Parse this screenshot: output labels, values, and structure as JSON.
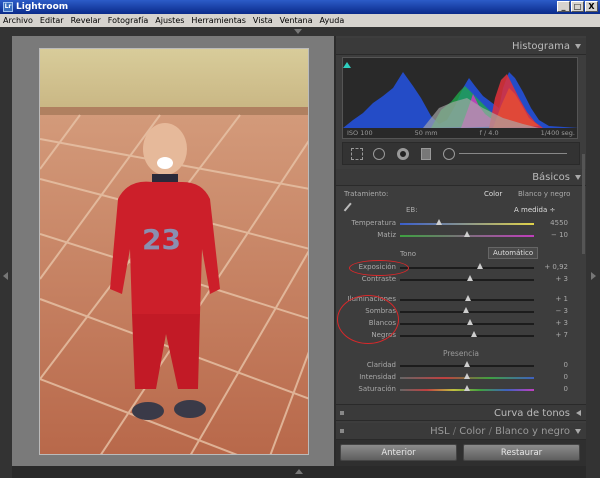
{
  "window": {
    "title": "Lightroom",
    "logo": "Lr",
    "controls": [
      "_",
      "□",
      "X"
    ]
  },
  "menu": [
    "Archivo",
    "Editar",
    "Revelar",
    "Fotografía",
    "Ajustes",
    "Herramientas",
    "Vista",
    "Ventana",
    "Ayuda"
  ],
  "histogram": {
    "title": "Histograma",
    "iso": "ISO 100",
    "focal": "50 mm",
    "aperture": "f / 4.0",
    "shutter": "1/400 seg."
  },
  "basic": {
    "title": "Básicos",
    "treatment_label": "Tratamiento:",
    "treatment_color": "Color",
    "treatment_bw": "Blanco y negro",
    "wb_label": "EB:",
    "wb_value": "A medida ÷",
    "temp_label": "Temperatura",
    "temp_value": "4550",
    "tint_label": "Matiz",
    "tint_value": "− 10",
    "tone_label": "Tono",
    "auto_label": "Automático",
    "sliders": [
      {
        "label": "Exposición",
        "value": "+ 0,92",
        "pos": 0.6
      },
      {
        "label": "Contraste",
        "value": "+ 3",
        "pos": 0.52
      },
      {
        "label": "Iluminaciones",
        "value": "+ 1",
        "pos": 0.51
      },
      {
        "label": "Sombras",
        "value": "− 3",
        "pos": 0.49
      },
      {
        "label": "Blancos",
        "value": "+ 3",
        "pos": 0.52
      },
      {
        "label": "Negros",
        "value": "+ 7",
        "pos": 0.55
      }
    ],
    "presence_label": "Presencia",
    "presence": [
      {
        "label": "Claridad",
        "value": "0",
        "pos": 0.5
      },
      {
        "label": "Intensidad",
        "value": "0",
        "pos": 0.5
      },
      {
        "label": "Saturación",
        "value": "0",
        "pos": 0.5
      }
    ]
  },
  "tone_curve": {
    "title": "Curva de tonos"
  },
  "hsl": {
    "hsl": "HSL",
    "sep1": "/",
    "color": "Color",
    "sep2": "/",
    "bw": "Blanco y negro"
  },
  "buttons": {
    "previous": "Anterior",
    "reset": "Restaurar"
  },
  "colors": {
    "accent": "#d8282a",
    "panel": "#3d3d3d"
  }
}
